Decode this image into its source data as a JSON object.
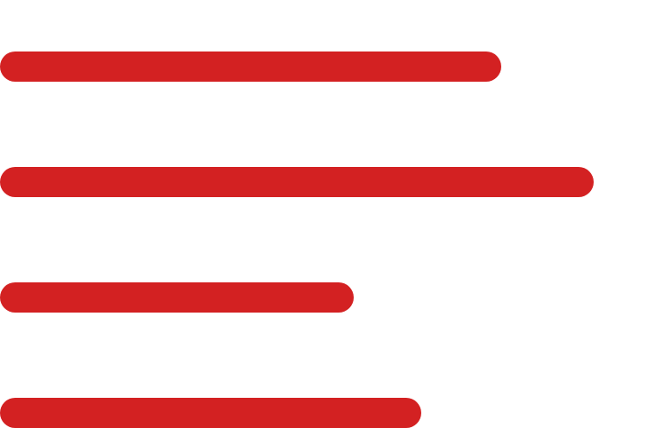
{
  "icon": {
    "name": "text-align-left-icon",
    "color": "#d32122",
    "background": "#ffffff",
    "lines": [
      {
        "length_fraction": 0.756
      },
      {
        "length_fraction": 0.895
      },
      {
        "length_fraction": 0.534
      },
      {
        "length_fraction": 0.635
      }
    ]
  }
}
